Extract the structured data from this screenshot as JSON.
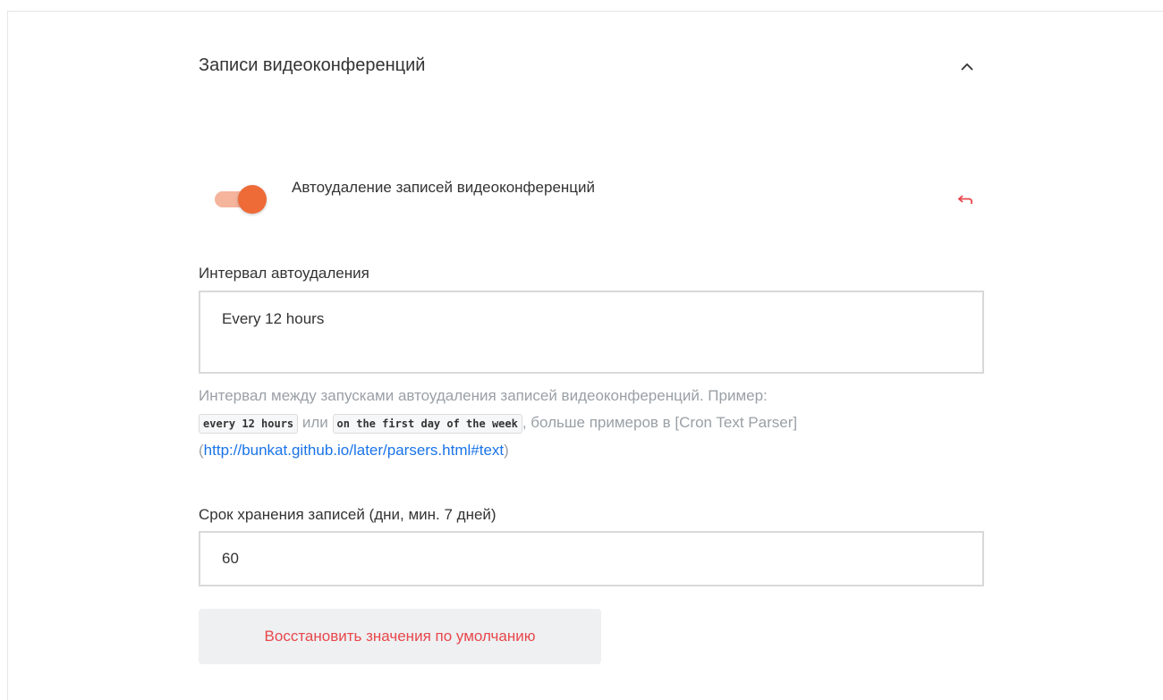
{
  "section": {
    "title": "Записи видеоконференций",
    "collapse_icon": "chevron-up-icon"
  },
  "auto_delete": {
    "label": "Автоудаление записей видеоконференций",
    "enabled": true,
    "accent_color": "#ee6a36",
    "reset_icon": "reset-arrow-icon",
    "reset_icon_color": "#e8474b"
  },
  "interval": {
    "label": "Интервал автоудаления",
    "value": "Every 12 hours",
    "help": {
      "text_before": "Интервал между запусками автоудаления записей видеоконференций. Пример:",
      "code1": "every 12 hours",
      "or": "или",
      "code2": "on the first day of the week",
      "text_after": ", больше примеров в [Cron Text Parser] (",
      "link": "http://bunkat.github.io/later/parsers.html#text",
      "close": ")"
    }
  },
  "retention": {
    "label": "Срок хранения записей (дни, мин. 7 дней)",
    "value": "60"
  },
  "restore_button": {
    "label": "Восстановить значения по умолчанию",
    "color": "#e8474b"
  }
}
